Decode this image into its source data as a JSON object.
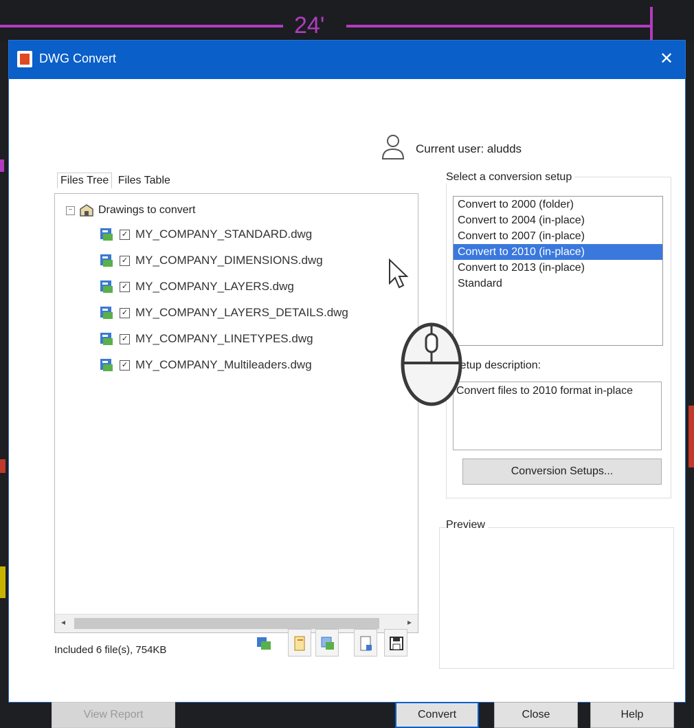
{
  "background": {
    "dimension_label": "24'",
    "accent_color": "#b23cc0"
  },
  "window": {
    "title": "DWG Convert",
    "close_label": "✕",
    "titlebar_color": "#0a5fc9"
  },
  "user": {
    "label": "Current user: aludds"
  },
  "tabs": {
    "files_tree": "Files Tree",
    "files_table": "Files Table"
  },
  "tree": {
    "root_label": "Drawings to convert",
    "expander": "−",
    "items": [
      {
        "label": "MY_COMPANY_STANDARD.dwg",
        "checked": true
      },
      {
        "label": "MY_COMPANY_DIMENSIONS.dwg",
        "checked": true
      },
      {
        "label": "MY_COMPANY_LAYERS.dwg",
        "checked": true
      },
      {
        "label": "MY_COMPANY_LAYERS_DETAILS.dwg",
        "checked": true
      },
      {
        "label": "MY_COMPANY_LINETYPES.dwg",
        "checked": true
      },
      {
        "label": "MY_COMPANY_Multileaders.dwg",
        "checked": true
      }
    ],
    "check_mark": "✓",
    "scroll_left": "◂",
    "scroll_right": "▸"
  },
  "status": {
    "included": "Included 6 file(s), 754KB"
  },
  "setup": {
    "label": "Select a conversion setup",
    "items": [
      "Convert to 2000 (folder)",
      "Convert to 2004 (in-place)",
      "Convert to 2007 (in-place)",
      "Convert to 2010 (in-place)",
      "Convert to 2013 (in-place)",
      "Standard"
    ],
    "selected_index": 3,
    "description_label": "Setup description:",
    "description_text": "Convert files to 2010 format in-place",
    "setups_button": "Conversion Setups..."
  },
  "preview": {
    "label": "Preview"
  },
  "footer": {
    "view_report": "View Report",
    "convert": "Convert",
    "close": "Close",
    "help": "Help"
  }
}
